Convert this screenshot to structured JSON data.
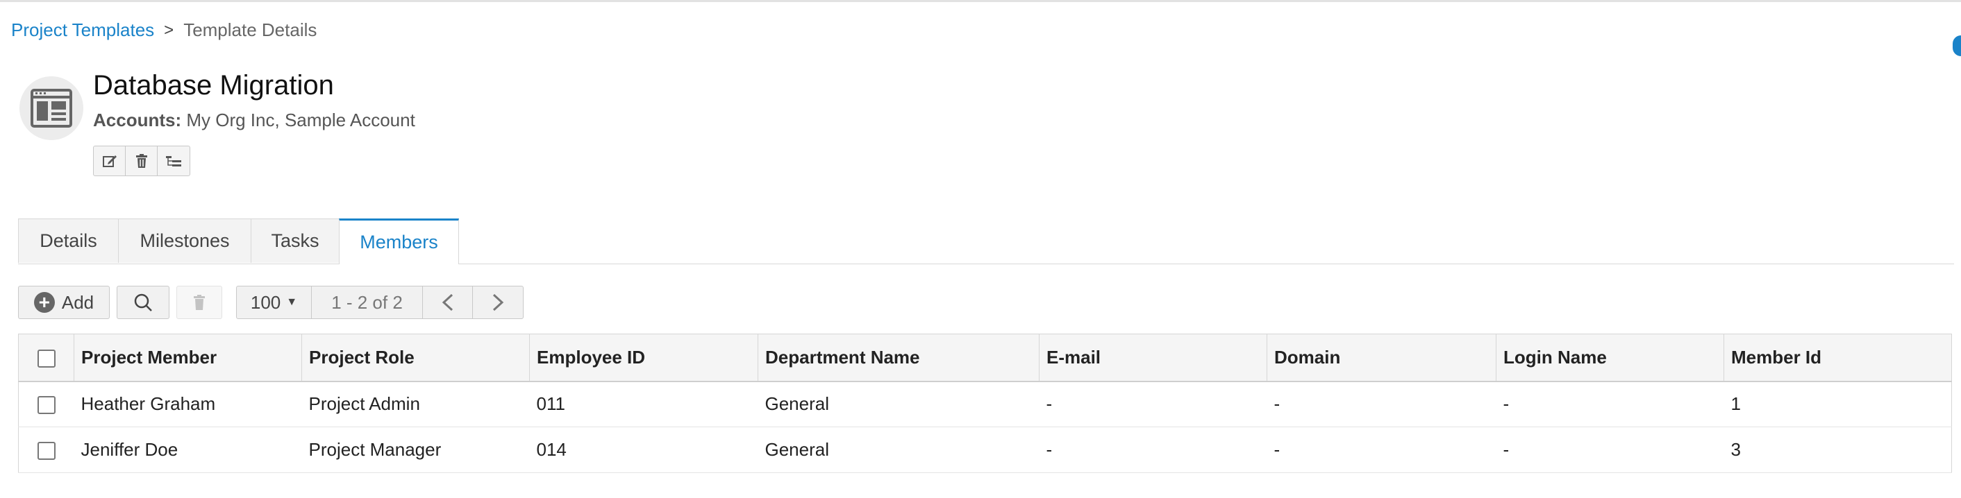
{
  "breadcrumb": {
    "root": "Project Templates",
    "separator": ">",
    "current": "Template Details"
  },
  "header": {
    "title": "Database Migration",
    "accounts_label": "Accounts:",
    "accounts_value": "My Org Inc, Sample Account",
    "icon": "template-icon",
    "actions": [
      "edit-icon",
      "trash-icon",
      "hierarchy-icon"
    ]
  },
  "tabs": [
    {
      "label": "Details",
      "active": false
    },
    {
      "label": "Milestones",
      "active": false
    },
    {
      "label": "Tasks",
      "active": false
    },
    {
      "label": "Members",
      "active": true
    }
  ],
  "toolbar": {
    "add_label": "Add",
    "page_size": "100",
    "range": "1 - 2 of 2"
  },
  "table": {
    "columns": [
      "Project Member",
      "Project Role",
      "Employee ID",
      "Department Name",
      "E-mail",
      "Domain",
      "Login Name",
      "Member Id"
    ],
    "rows": [
      [
        "Heather Graham",
        "Project Admin",
        "011",
        "General",
        "-",
        "-",
        "-",
        "1"
      ],
      [
        "Jeniffer Doe",
        "Project Manager",
        "014",
        "General",
        "-",
        "-",
        "-",
        "3"
      ]
    ]
  },
  "colors": {
    "accent": "#1a83c9",
    "tab_bg": "#f3f3f3",
    "header_bg": "#f5f5f5"
  }
}
